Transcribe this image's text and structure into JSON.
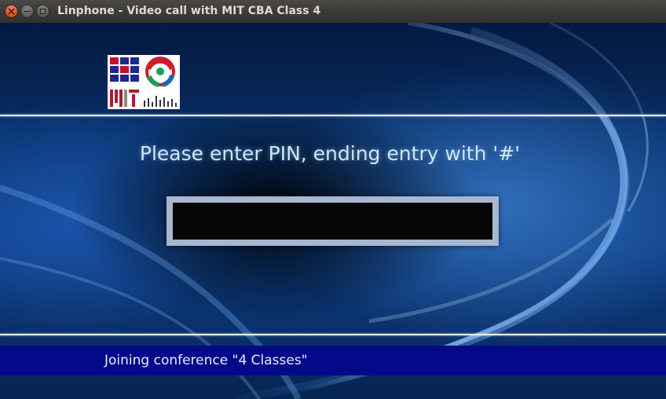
{
  "window": {
    "title": "Linphone - Video call with MIT CBA Class 4",
    "controls": [
      "close-icon",
      "minimize-icon",
      "maximize-icon"
    ]
  },
  "conference": {
    "pin_prompt": "Please enter PIN, ending entry with '#'",
    "pin_value": "",
    "status": "Joining conference \"4 Classes\""
  },
  "logo": {
    "lettering": "MIT",
    "icons": [
      "mit-cba-logo",
      "fab-lab-logo"
    ]
  },
  "colors": {
    "titlebar": "#3b3a36",
    "close_button": "#e5592a",
    "background_blue": "#0a3a7c",
    "status_bar": "#04098a",
    "pin_border": "#a7b7cf",
    "text": "#cfe6ff"
  }
}
